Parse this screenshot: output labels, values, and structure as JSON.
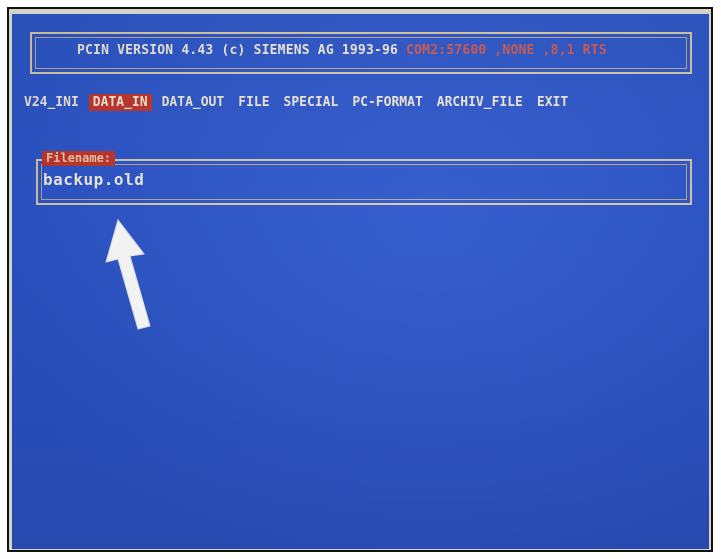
{
  "title": {
    "main": "PCIN VERSION 4.43 (c) SIEMENS AG 1993-96",
    "status": "COM2:57600 ,NONE ,8,1 RTS"
  },
  "menu": {
    "items": [
      {
        "label": "V24_INI"
      },
      {
        "label": "DATA_IN"
      },
      {
        "label": "DATA_OUT"
      },
      {
        "label": "FILE"
      },
      {
        "label": "SPECIAL"
      },
      {
        "label": "PC-FORMAT"
      },
      {
        "label": "ARCHIV_FILE"
      },
      {
        "label": "EXIT"
      }
    ],
    "active": "DATA_IN"
  },
  "filename_field": {
    "label": "Filename:",
    "value": "backup.old"
  },
  "colors": {
    "screen_background": "#2b55cc",
    "menu_highlight": "#c0362c",
    "text": "#efe8d6",
    "arrow": "#ffffff"
  },
  "icons": {
    "annotation_arrow": "up-arrow-icon"
  }
}
